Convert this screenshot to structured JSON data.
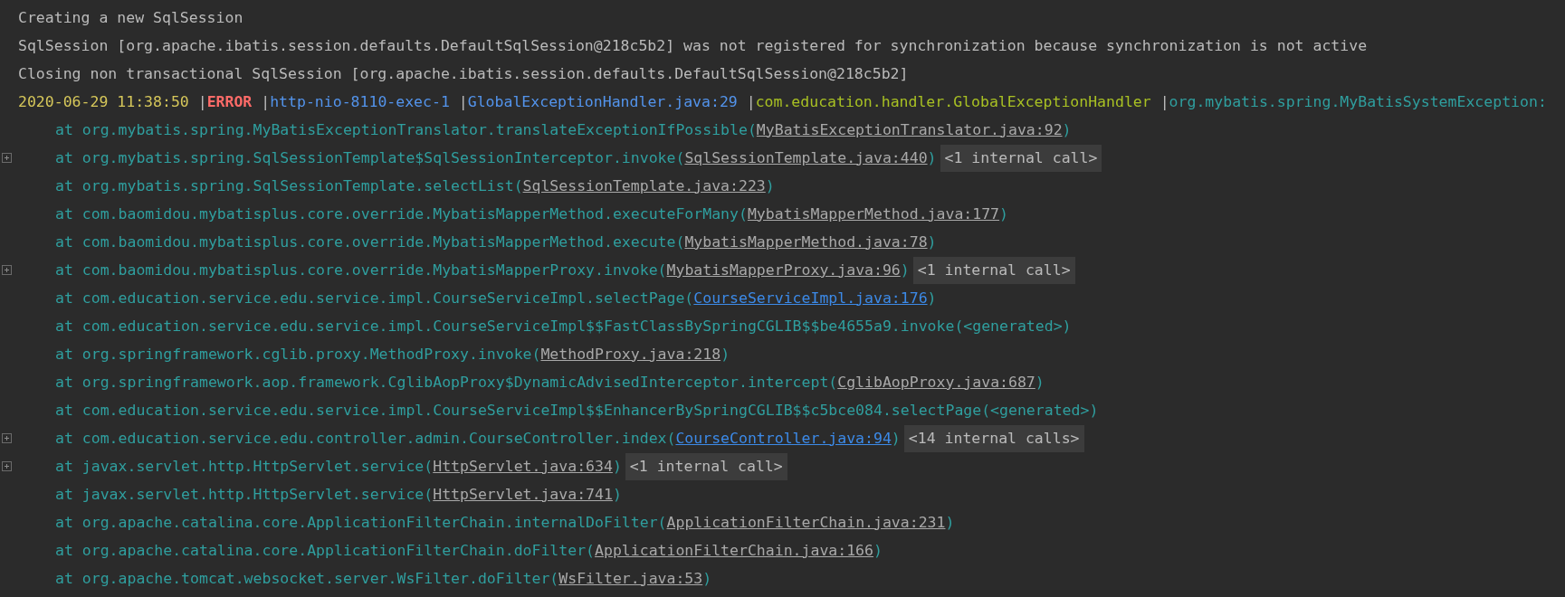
{
  "console": {
    "lines": [
      {
        "kind": "plain",
        "text": "Creating a new SqlSession"
      },
      {
        "kind": "plain",
        "text": "SqlSession [org.apache.ibatis.session.defaults.DefaultSqlSession@218c5b2] was not registered for synchronization because synchronization is not active"
      },
      {
        "kind": "plain",
        "text": "Closing non transactional SqlSession [org.apache.ibatis.session.defaults.DefaultSqlSession@218c5b2]"
      },
      {
        "kind": "log",
        "fields": [
          {
            "kind": "timestamp",
            "text": "2020-06-29 11:38:50 "
          },
          {
            "kind": "separator",
            "text": "|"
          },
          {
            "kind": "level",
            "text": "ERROR "
          },
          {
            "kind": "separator",
            "text": "|"
          },
          {
            "kind": "thread",
            "text": "http-nio-8110-exec-1 "
          },
          {
            "kind": "separator",
            "text": "|"
          },
          {
            "kind": "source",
            "text": "GlobalExceptionHandler.java:29 "
          },
          {
            "kind": "separator",
            "text": "|"
          },
          {
            "kind": "logger",
            "text": "com.education.handler.GlobalExceptionHandler "
          },
          {
            "kind": "separator",
            "text": "|"
          },
          {
            "kind": "message",
            "text": "org.mybatis.spring.MyBatisSystemException:"
          }
        ]
      },
      {
        "kind": "stack",
        "call": "at org.mybatis.spring.MyBatisExceptionTranslator.translateExceptionIfPossible(",
        "link": "MyBatisExceptionTranslator.java:92",
        "in_project": false,
        "tail": ")"
      },
      {
        "kind": "stack",
        "call": "at org.mybatis.spring.SqlSessionTemplate$SqlSessionInterceptor.invoke(",
        "link": "SqlSessionTemplate.java:440",
        "in_project": false,
        "tail": ")",
        "internal_calls": "<1 internal call>"
      },
      {
        "kind": "stack",
        "call": "at org.mybatis.spring.SqlSessionTemplate.selectList(",
        "link": "SqlSessionTemplate.java:223",
        "in_project": false,
        "tail": ")"
      },
      {
        "kind": "stack",
        "call": "at com.baomidou.mybatisplus.core.override.MybatisMapperMethod.executeForMany(",
        "link": "MybatisMapperMethod.java:177",
        "in_project": false,
        "tail": ")"
      },
      {
        "kind": "stack",
        "call": "at com.baomidou.mybatisplus.core.override.MybatisMapperMethod.execute(",
        "link": "MybatisMapperMethod.java:78",
        "in_project": false,
        "tail": ")"
      },
      {
        "kind": "stack",
        "call": "at com.baomidou.mybatisplus.core.override.MybatisMapperProxy.invoke(",
        "link": "MybatisMapperProxy.java:96",
        "in_project": false,
        "tail": ")",
        "internal_calls": "<1 internal call>"
      },
      {
        "kind": "stack",
        "call": "at com.education.service.edu.service.impl.CourseServiceImpl.selectPage(",
        "link": "CourseServiceImpl.java:176",
        "in_project": true,
        "tail": ")"
      },
      {
        "kind": "stack",
        "call": "at com.education.service.edu.service.impl.CourseServiceImpl$$FastClassBySpringCGLIB$$be4655a9.invoke(<generated>)"
      },
      {
        "kind": "stack",
        "call": "at org.springframework.cglib.proxy.MethodProxy.invoke(",
        "link": "MethodProxy.java:218",
        "in_project": false,
        "tail": ")"
      },
      {
        "kind": "stack",
        "call": "at org.springframework.aop.framework.CglibAopProxy$DynamicAdvisedInterceptor.intercept(",
        "link": "CglibAopProxy.java:687",
        "in_project": false,
        "tail": ")"
      },
      {
        "kind": "stack",
        "call": "at com.education.service.edu.service.impl.CourseServiceImpl$$EnhancerBySpringCGLIB$$c5bce084.selectPage(<generated>)"
      },
      {
        "kind": "stack",
        "call": "at com.education.service.edu.controller.admin.CourseController.index(",
        "link": "CourseController.java:94",
        "in_project": true,
        "tail": ")",
        "internal_calls": "<14 internal calls>"
      },
      {
        "kind": "stack",
        "call": "at javax.servlet.http.HttpServlet.service(",
        "link": "HttpServlet.java:634",
        "in_project": false,
        "tail": ")",
        "internal_calls": "<1 internal call>"
      },
      {
        "kind": "stack",
        "call": "at javax.servlet.http.HttpServlet.service(",
        "link": "HttpServlet.java:741",
        "in_project": false,
        "tail": ")"
      },
      {
        "kind": "stack",
        "call": "at org.apache.catalina.core.ApplicationFilterChain.internalDoFilter(",
        "link": "ApplicationFilterChain.java:231",
        "in_project": false,
        "tail": ")"
      },
      {
        "kind": "stack",
        "call": "at org.apache.catalina.core.ApplicationFilterChain.doFilter(",
        "link": "ApplicationFilterChain.java:166",
        "in_project": false,
        "tail": ")"
      },
      {
        "kind": "stack",
        "call": "at org.apache.tomcat.websocket.server.WsFilter.doFilter(",
        "link": "WsFilter.java:53",
        "in_project": false,
        "tail": ")"
      }
    ]
  }
}
